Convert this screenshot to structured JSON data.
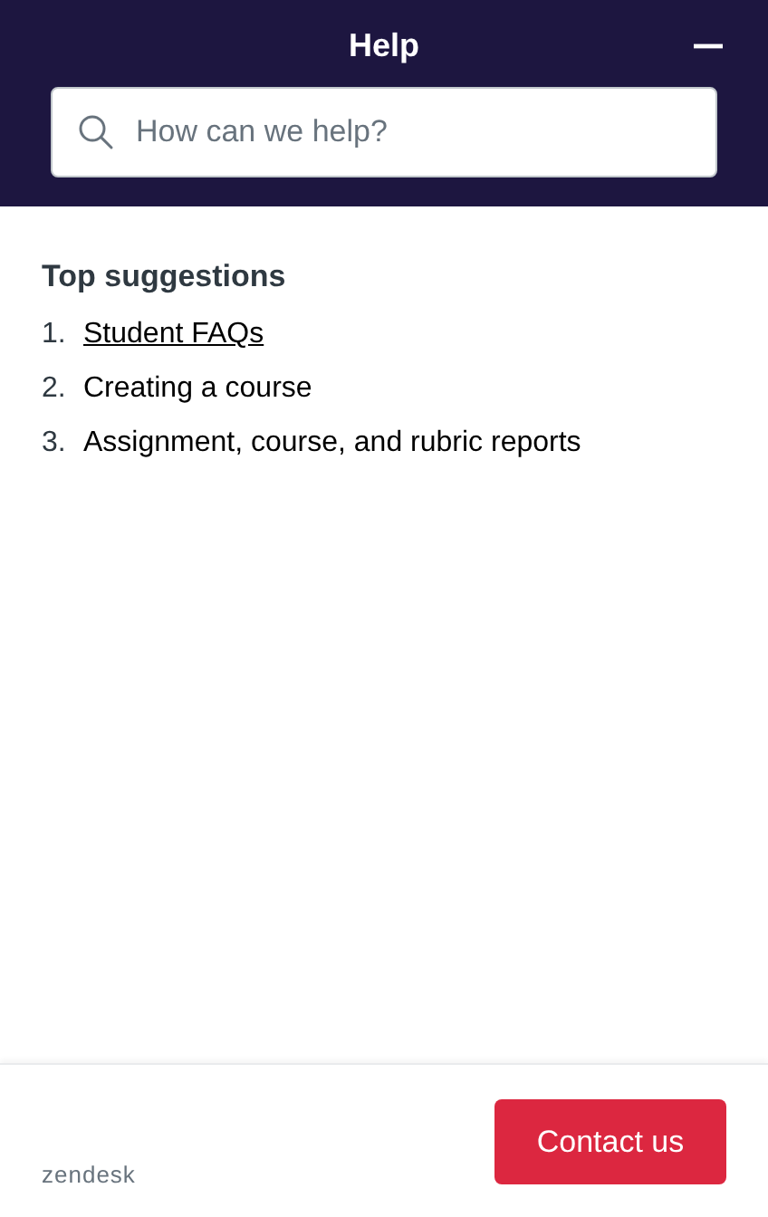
{
  "header": {
    "title": "Help"
  },
  "search": {
    "placeholder": "How can we help?"
  },
  "suggestions": {
    "heading": "Top suggestions",
    "items": [
      {
        "number": "1.",
        "label": "Student FAQs",
        "highlighted": true
      },
      {
        "number": "2.",
        "label": "Creating a course",
        "highlighted": false
      },
      {
        "number": "3.",
        "label": "Assignment, course, and rubric reports",
        "highlighted": false
      }
    ]
  },
  "footer": {
    "brand": "zendesk",
    "button": "Contact us"
  }
}
